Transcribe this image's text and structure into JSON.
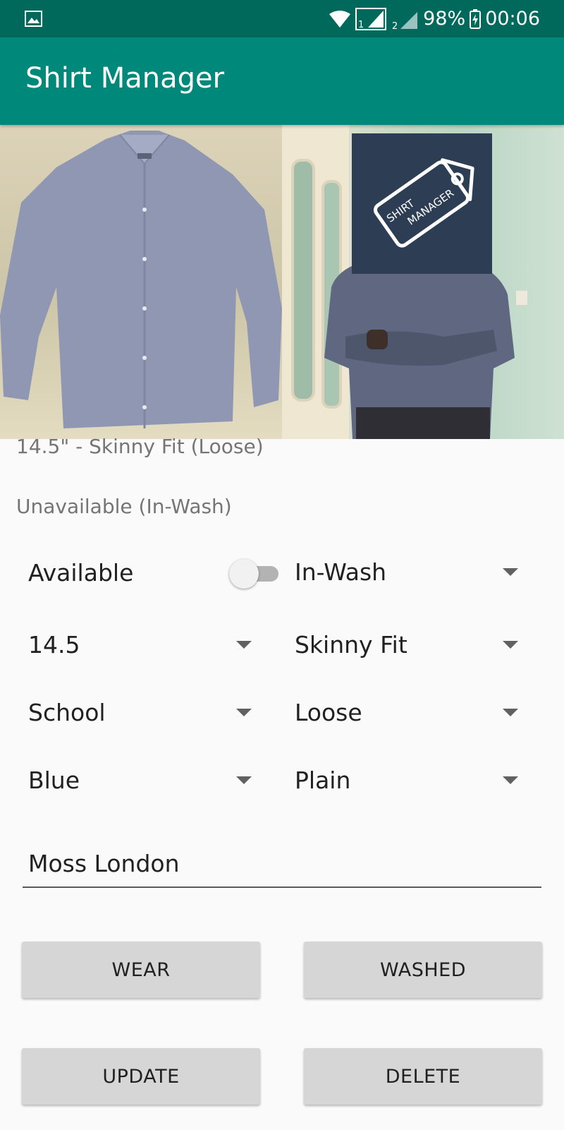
{
  "status_bar": {
    "battery": "98%",
    "time": "00:06",
    "sim1_label": "1",
    "sim2_label": "2",
    "icons": [
      "gallery-icon",
      "wifi-icon",
      "signal-icon",
      "signal-icon",
      "battery-charging-icon"
    ]
  },
  "app_bar": {
    "title": "Shirt Manager"
  },
  "photos": {
    "logo_text_line1": "SHIRT",
    "logo_text_line2": "MANAGER"
  },
  "details": {
    "summary": "14.5\" - Skinny Fit (Loose)",
    "status": "Unavailable (In-Wash)"
  },
  "form": {
    "available_label": "Available",
    "available_on": false,
    "wash_state": "In-Wash",
    "size": "14.5",
    "fit": "Skinny Fit",
    "usage": "School",
    "tightness": "Loose",
    "colour": "Blue",
    "pattern": "Plain",
    "brand": "Moss London"
  },
  "buttons": {
    "wear": "WEAR",
    "washed": "WASHED",
    "update": "UPDATE",
    "delete": "DELETE"
  },
  "colors": {
    "status_bar": "#00695c",
    "app_bar": "#00897b",
    "logo_tile": "#2d3e54",
    "button": "#d6d6d6"
  }
}
